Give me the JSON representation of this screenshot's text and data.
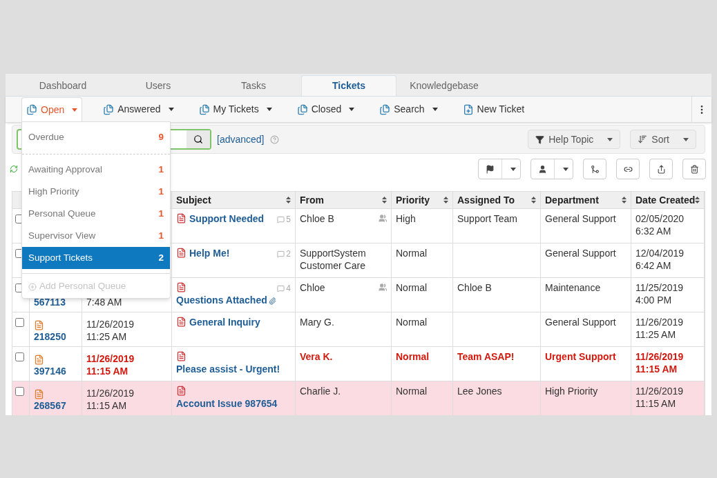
{
  "tabs": [
    {
      "label": "Dashboard",
      "selected": false
    },
    {
      "label": "Users",
      "selected": false
    },
    {
      "label": "Tasks",
      "selected": false
    },
    {
      "label": "Tickets",
      "selected": true
    },
    {
      "label": "Knowledgebase",
      "selected": false
    }
  ],
  "toolbar": [
    {
      "label": "Open",
      "kind": "queue",
      "selected": true
    },
    {
      "label": "Answered",
      "kind": "queue",
      "selected": false
    },
    {
      "label": "My Tickets",
      "kind": "queue",
      "selected": false
    },
    {
      "label": "Closed",
      "kind": "queue",
      "selected": false
    },
    {
      "label": "Search",
      "kind": "queue",
      "selected": false
    },
    {
      "label": "New Ticket",
      "kind": "new",
      "selected": false
    }
  ],
  "search": {
    "advanced_link": "[advanced]"
  },
  "filters": [
    "Help Topic",
    "Sort"
  ],
  "queue_menu": {
    "sections": [
      [
        {
          "label": "Overdue",
          "count": "9",
          "selected": false
        }
      ],
      [
        {
          "label": "Awaiting Approval",
          "count": "1",
          "selected": false
        },
        {
          "label": "High Priority",
          "count": "1",
          "selected": false
        },
        {
          "label": "Personal Queue",
          "count": "1",
          "selected": false
        },
        {
          "label": "Supervisor View",
          "count": "1",
          "selected": false
        },
        {
          "label": "Support Tickets",
          "count": "2",
          "selected": true
        }
      ]
    ],
    "add_item": {
      "label": "Add Personal Queue",
      "disabled": true
    }
  },
  "table": {
    "columns": [
      "Subject",
      "From",
      "Priority",
      "Assigned To",
      "Department",
      "Date Created"
    ],
    "rows": [
      {
        "kind": "normal",
        "checked": false,
        "number": "",
        "date": "",
        "subject": "Support Needed",
        "threads": "5",
        "attachment": false,
        "from": "Chloe B",
        "collaborators": true,
        "priority": "High",
        "assigned": "Support Team",
        "department": "General Support",
        "created": "02/05/2020 6:32 AM"
      },
      {
        "kind": "normal",
        "checked": false,
        "number": "",
        "date": "",
        "subject": "Help Me!",
        "threads": "2",
        "attachment": false,
        "from": "SupportSystem Customer Care",
        "collaborators": false,
        "priority": "Normal",
        "assigned": "",
        "department": "General Support",
        "created": "12/04/2019 6:42 AM"
      },
      {
        "kind": "normal",
        "checked": false,
        "number": "567113",
        "date": "7:48 AM",
        "subject": "Questions Attached",
        "threads": "4",
        "attachment": true,
        "from": "Chloe",
        "collaborators": true,
        "priority": "Normal",
        "assigned": "Chloe B",
        "department": "Maintenance",
        "created": "11/25/2019 4:00 PM"
      },
      {
        "kind": "normal",
        "checked": false,
        "number": "218250",
        "date": "11/26/2019 11:25 AM",
        "subject": "General Inquiry",
        "threads": "",
        "attachment": false,
        "from": "Mary G.",
        "collaborators": false,
        "priority": "Normal",
        "assigned": "",
        "department": "General Support",
        "created": "11/26/2019 11:25 AM"
      },
      {
        "kind": "overdue",
        "checked": false,
        "number": "397146",
        "date": "11/26/2019 11:15 AM",
        "subject": "Please assist - Urgent!",
        "threads": "",
        "attachment": false,
        "from": "Vera K.",
        "collaborators": false,
        "priority": "Normal",
        "assigned": "Team ASAP!",
        "department": "Urgent Support",
        "created": "11/26/2019 11:15 AM"
      },
      {
        "kind": "highlight",
        "checked": false,
        "number": "268567",
        "date": "11/26/2019 11:15 AM",
        "subject": "Account Issue 987654",
        "threads": "",
        "attachment": false,
        "from": "Charlie J.",
        "collaborators": false,
        "priority": "Normal",
        "assigned": "Lee Jones",
        "department": "High Priority",
        "created": "11/26/2019 11:15 AM"
      }
    ]
  }
}
